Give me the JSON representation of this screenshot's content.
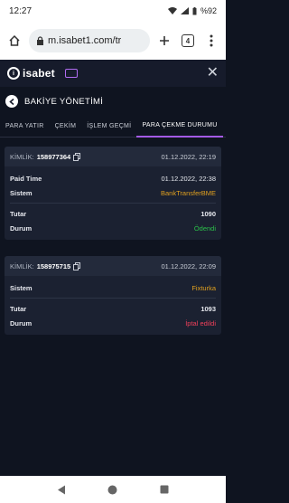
{
  "status_bar": {
    "time": "12:27",
    "battery": "%92"
  },
  "browser": {
    "url": "m.isabet1.com/tr",
    "tab_count": "4"
  },
  "app": {
    "logo_text": "isabet",
    "logo_mark": "i"
  },
  "page": {
    "title": "BAKİYE YÖNETİMİ"
  },
  "tabs": [
    {
      "label": "PARA YATIR",
      "active": false
    },
    {
      "label": "ÇEKİM",
      "active": false
    },
    {
      "label": "İŞLEM GEÇMİ",
      "active": false
    },
    {
      "label": "PARA ÇEKME DURUMU",
      "active": true
    }
  ],
  "cards": [
    {
      "id_label": "KİMLİK:",
      "id_value": "158977364",
      "date": "01.12.2022, 22:19",
      "rows_top": [
        {
          "label": "Paid Time",
          "value": "01.12.2022, 22:38"
        },
        {
          "label": "Sistem",
          "value": "BankTransferBME"
        }
      ],
      "rows_bottom": [
        {
          "label": "Tutar",
          "value": "1090"
        },
        {
          "label": "Durum",
          "value": "Ödendi"
        }
      ]
    },
    {
      "id_label": "KİMLİK:",
      "id_value": "158975715",
      "date": "01.12.2022, 22:09",
      "rows_top": [
        {
          "label": "Sistem",
          "value": "Fixturka"
        }
      ],
      "rows_bottom": [
        {
          "label": "Tutar",
          "value": "1093"
        },
        {
          "label": "Durum",
          "value": "İptal edildi"
        }
      ]
    }
  ],
  "colors": {
    "accent": "#a45be6",
    "paid": "#2bc14a",
    "cancelled": "#f0405a",
    "system": "#e0a01f",
    "background": "#0f1420"
  },
  "icons": [
    "home-icon",
    "lock-icon",
    "add-tab-icon",
    "more-vert-icon",
    "close-icon",
    "back-arrow-icon",
    "copy-icon",
    "nav-back-icon",
    "nav-home-icon",
    "nav-recents-icon"
  ]
}
